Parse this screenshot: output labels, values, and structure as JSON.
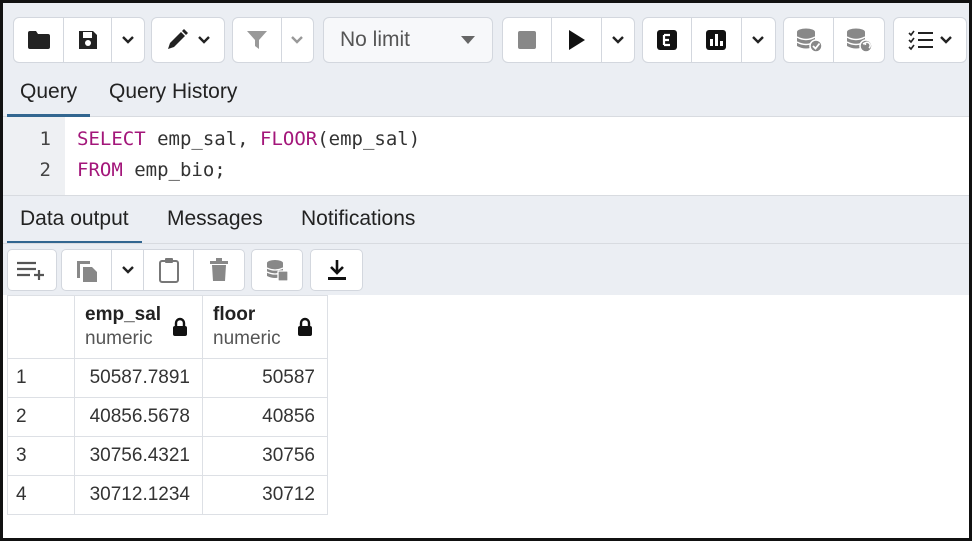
{
  "toolbar": {
    "limit_label": "No limit"
  },
  "query_tabs": [
    {
      "label": "Query",
      "active": true
    },
    {
      "label": "Query History",
      "active": false
    }
  ],
  "editor": {
    "lines": [
      {
        "num": "1",
        "keyword": "SELECT",
        "rest_a": " emp_sal, ",
        "fn": "FLOOR",
        "rest_b": "(emp_sal)"
      },
      {
        "num": "2",
        "keyword": "FROM",
        "rest_a": " emp_bio;"
      }
    ]
  },
  "output_tabs": [
    {
      "label": "Data output",
      "active": true
    },
    {
      "label": "Messages",
      "active": false
    },
    {
      "label": "Notifications",
      "active": false
    }
  ],
  "grid": {
    "columns": [
      {
        "name": "emp_sal",
        "type": "numeric"
      },
      {
        "name": "floor",
        "type": "numeric"
      }
    ],
    "rows": [
      {
        "n": "1",
        "emp_sal": "50587.7891",
        "floor": "50587"
      },
      {
        "n": "2",
        "emp_sal": "40856.5678",
        "floor": "40856"
      },
      {
        "n": "3",
        "emp_sal": "30756.4321",
        "floor": "30756"
      },
      {
        "n": "4",
        "emp_sal": "30712.1234",
        "floor": "30712"
      }
    ]
  },
  "colors": {
    "keyword": "#a3167a",
    "active_tab": "#326690",
    "panel_bg": "#ebeef3"
  }
}
